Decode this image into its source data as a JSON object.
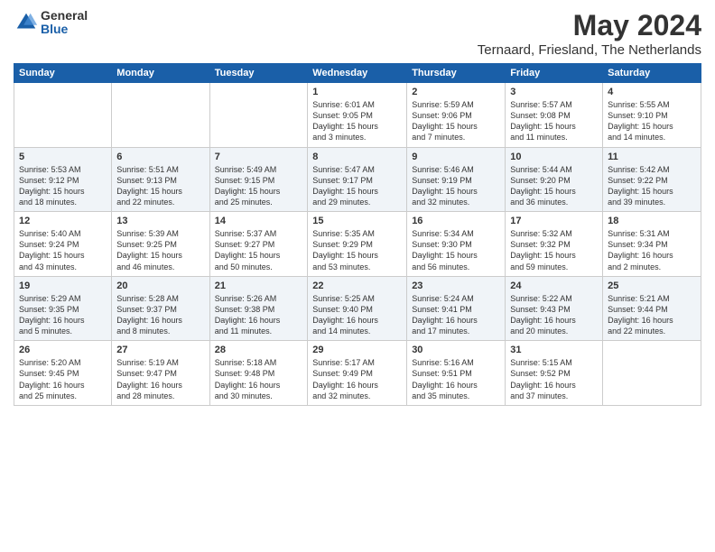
{
  "header": {
    "logo_general": "General",
    "logo_blue": "Blue",
    "month_title": "May 2024",
    "location": "Ternaard, Friesland, The Netherlands"
  },
  "days_of_week": [
    "Sunday",
    "Monday",
    "Tuesday",
    "Wednesday",
    "Thursday",
    "Friday",
    "Saturday"
  ],
  "weeks": [
    [
      {
        "day": "",
        "info": ""
      },
      {
        "day": "",
        "info": ""
      },
      {
        "day": "",
        "info": ""
      },
      {
        "day": "1",
        "info": "Sunrise: 6:01 AM\nSunset: 9:05 PM\nDaylight: 15 hours\nand 3 minutes."
      },
      {
        "day": "2",
        "info": "Sunrise: 5:59 AM\nSunset: 9:06 PM\nDaylight: 15 hours\nand 7 minutes."
      },
      {
        "day": "3",
        "info": "Sunrise: 5:57 AM\nSunset: 9:08 PM\nDaylight: 15 hours\nand 11 minutes."
      },
      {
        "day": "4",
        "info": "Sunrise: 5:55 AM\nSunset: 9:10 PM\nDaylight: 15 hours\nand 14 minutes."
      }
    ],
    [
      {
        "day": "5",
        "info": "Sunrise: 5:53 AM\nSunset: 9:12 PM\nDaylight: 15 hours\nand 18 minutes."
      },
      {
        "day": "6",
        "info": "Sunrise: 5:51 AM\nSunset: 9:13 PM\nDaylight: 15 hours\nand 22 minutes."
      },
      {
        "day": "7",
        "info": "Sunrise: 5:49 AM\nSunset: 9:15 PM\nDaylight: 15 hours\nand 25 minutes."
      },
      {
        "day": "8",
        "info": "Sunrise: 5:47 AM\nSunset: 9:17 PM\nDaylight: 15 hours\nand 29 minutes."
      },
      {
        "day": "9",
        "info": "Sunrise: 5:46 AM\nSunset: 9:19 PM\nDaylight: 15 hours\nand 32 minutes."
      },
      {
        "day": "10",
        "info": "Sunrise: 5:44 AM\nSunset: 9:20 PM\nDaylight: 15 hours\nand 36 minutes."
      },
      {
        "day": "11",
        "info": "Sunrise: 5:42 AM\nSunset: 9:22 PM\nDaylight: 15 hours\nand 39 minutes."
      }
    ],
    [
      {
        "day": "12",
        "info": "Sunrise: 5:40 AM\nSunset: 9:24 PM\nDaylight: 15 hours\nand 43 minutes."
      },
      {
        "day": "13",
        "info": "Sunrise: 5:39 AM\nSunset: 9:25 PM\nDaylight: 15 hours\nand 46 minutes."
      },
      {
        "day": "14",
        "info": "Sunrise: 5:37 AM\nSunset: 9:27 PM\nDaylight: 15 hours\nand 50 minutes."
      },
      {
        "day": "15",
        "info": "Sunrise: 5:35 AM\nSunset: 9:29 PM\nDaylight: 15 hours\nand 53 minutes."
      },
      {
        "day": "16",
        "info": "Sunrise: 5:34 AM\nSunset: 9:30 PM\nDaylight: 15 hours\nand 56 minutes."
      },
      {
        "day": "17",
        "info": "Sunrise: 5:32 AM\nSunset: 9:32 PM\nDaylight: 15 hours\nand 59 minutes."
      },
      {
        "day": "18",
        "info": "Sunrise: 5:31 AM\nSunset: 9:34 PM\nDaylight: 16 hours\nand 2 minutes."
      }
    ],
    [
      {
        "day": "19",
        "info": "Sunrise: 5:29 AM\nSunset: 9:35 PM\nDaylight: 16 hours\nand 5 minutes."
      },
      {
        "day": "20",
        "info": "Sunrise: 5:28 AM\nSunset: 9:37 PM\nDaylight: 16 hours\nand 8 minutes."
      },
      {
        "day": "21",
        "info": "Sunrise: 5:26 AM\nSunset: 9:38 PM\nDaylight: 16 hours\nand 11 minutes."
      },
      {
        "day": "22",
        "info": "Sunrise: 5:25 AM\nSunset: 9:40 PM\nDaylight: 16 hours\nand 14 minutes."
      },
      {
        "day": "23",
        "info": "Sunrise: 5:24 AM\nSunset: 9:41 PM\nDaylight: 16 hours\nand 17 minutes."
      },
      {
        "day": "24",
        "info": "Sunrise: 5:22 AM\nSunset: 9:43 PM\nDaylight: 16 hours\nand 20 minutes."
      },
      {
        "day": "25",
        "info": "Sunrise: 5:21 AM\nSunset: 9:44 PM\nDaylight: 16 hours\nand 22 minutes."
      }
    ],
    [
      {
        "day": "26",
        "info": "Sunrise: 5:20 AM\nSunset: 9:45 PM\nDaylight: 16 hours\nand 25 minutes."
      },
      {
        "day": "27",
        "info": "Sunrise: 5:19 AM\nSunset: 9:47 PM\nDaylight: 16 hours\nand 28 minutes."
      },
      {
        "day": "28",
        "info": "Sunrise: 5:18 AM\nSunset: 9:48 PM\nDaylight: 16 hours\nand 30 minutes."
      },
      {
        "day": "29",
        "info": "Sunrise: 5:17 AM\nSunset: 9:49 PM\nDaylight: 16 hours\nand 32 minutes."
      },
      {
        "day": "30",
        "info": "Sunrise: 5:16 AM\nSunset: 9:51 PM\nDaylight: 16 hours\nand 35 minutes."
      },
      {
        "day": "31",
        "info": "Sunrise: 5:15 AM\nSunset: 9:52 PM\nDaylight: 16 hours\nand 37 minutes."
      },
      {
        "day": "",
        "info": ""
      }
    ]
  ]
}
